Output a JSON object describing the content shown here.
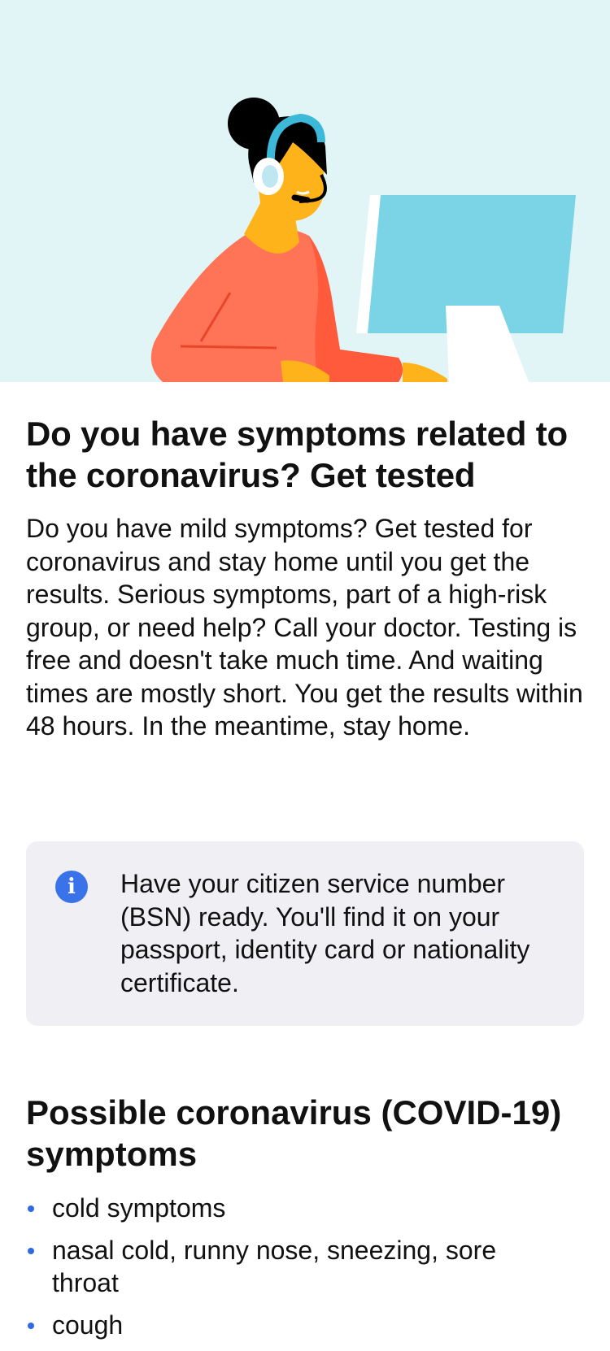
{
  "hero": {
    "illustration": "support-agent-at-computer-illustration",
    "colors": {
      "background": "#e1f5f6",
      "monitor": "#7ad4e6",
      "shirt": "#ff7357",
      "skin": "#ffb31a",
      "hair": "#000000",
      "headset": "#3cb8d8"
    }
  },
  "title": "Do you have symptoms related to the coronavirus? Get tested",
  "intro": "Do you have mild symptoms? Get tested for coronavirus and stay home until you get the results. Serious symptoms, part of a high-risk group, or need help? Call your doctor. Testing is free and doesn't take much time. And waiting times are mostly short. You get the results within 48 hours. In the meantime, stay home.",
  "info": {
    "icon": "info-icon",
    "icon_glyph": "i",
    "text": "Have your citizen service number (BSN) ready. You'll find it on your passport, identity card or nationality certificate."
  },
  "symptoms": {
    "title": "Possible coronavirus (COVID-19) symptoms",
    "items": [
      "cold symptoms",
      "nasal cold, runny nose, sneezing, sore throat",
      "cough"
    ]
  }
}
